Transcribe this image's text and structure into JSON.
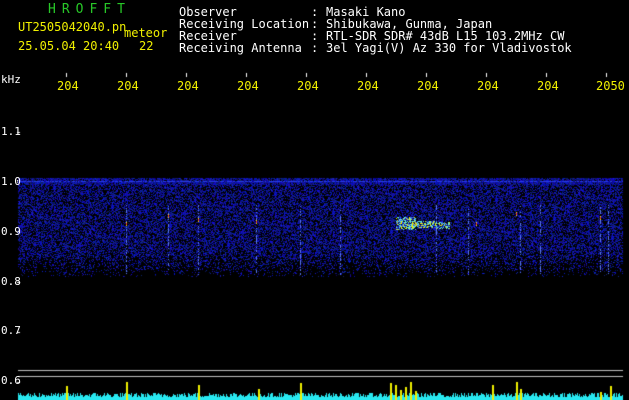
{
  "header": {
    "app_title": "HROFFT",
    "filename": "UT2505042040.pn",
    "tag": "meteor",
    "datetime": "25.05.04 20:40",
    "count": "22",
    "fields": [
      {
        "label": "Observer",
        "value": "Masaki Kano"
      },
      {
        "label": "Receiving Location",
        "value": "Shibukawa, Gunma, Japan"
      },
      {
        "label": "Receiver",
        "value": "RTL-SDR SDR# 43dB L15 103.2MHz CW"
      },
      {
        "label": "Receiving Antenna",
        "value": "3el Yagi(V) Az 330 for Vladivostok"
      }
    ]
  },
  "x_axis": {
    "ticks": [
      "204",
      "204",
      "204",
      "204",
      "204",
      "204",
      "204",
      "204",
      "204",
      "2050"
    ]
  },
  "y_axis": {
    "unit": "kHz",
    "ticks": [
      "1.1",
      "1.0",
      "0.9",
      "0.8",
      "0.7",
      "0.6"
    ]
  },
  "colors": {
    "background": "#000000",
    "title": "#28c828",
    "text_yellow": "#f0f000",
    "noise_band": "#1e28b4",
    "signal": "#f0f000",
    "echo": "#60f0e0",
    "bottom_trace": "#28e8f0"
  }
}
